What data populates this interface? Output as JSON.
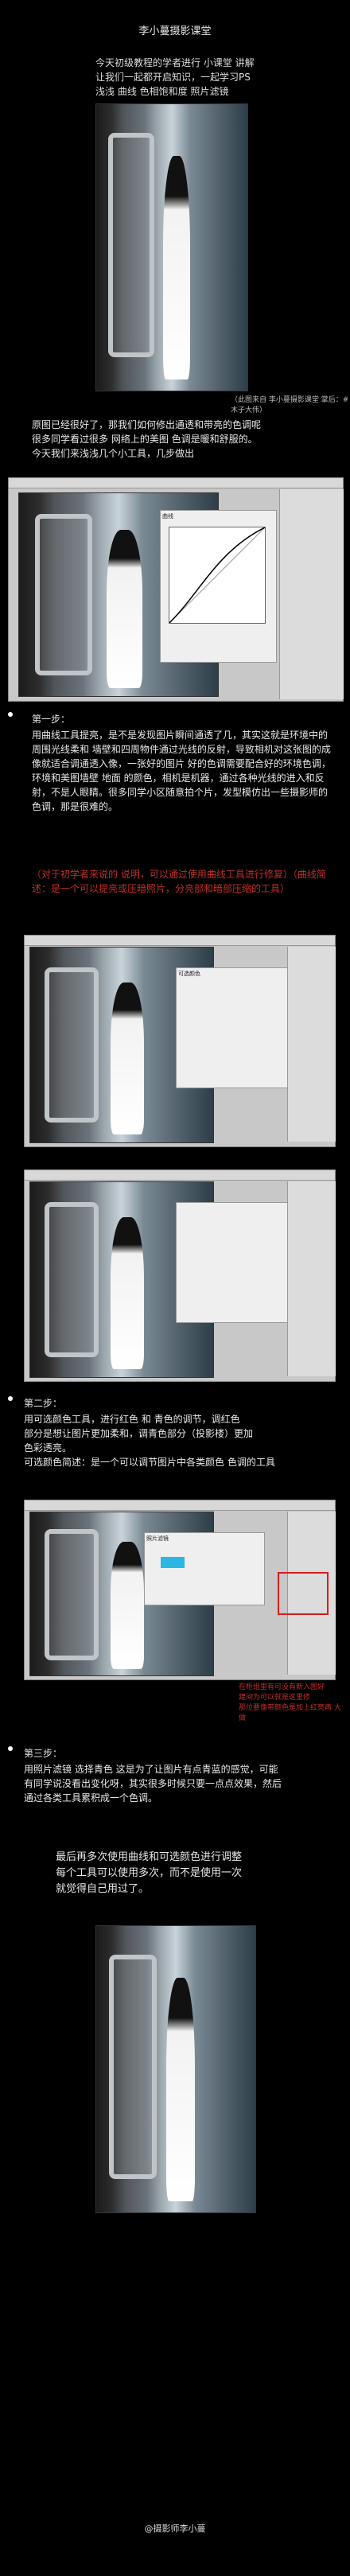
{
  "title": "李小蔓摄影课堂",
  "intro": [
    "今天初级教程的学者进行 小课堂 讲解",
    "让我们一起都开启知识，一起学习PS",
    "浅浅 曲线 色相饱和度 照片滤镜"
  ],
  "photo_caption": "（此图来自 李小蔓摄影课堂 掌后：#木子大伟）",
  "intro2": [
    "原图已经很好了，那我们如何修出通透和带亮的色调呢",
    "很多同学看过很多 网络上的美图 色调是暖和舒服的。",
    "今天我们来浅浅几个小工具，几步做出"
  ],
  "step1": {
    "heading": "第一步：",
    "body": "用曲线工具提亮，是不是发现图片瞬间通透了几，其实这就是环境中的周围光线柔和 墙壁和四周物件通过光线的反射，导致相机对这张图的成像就适合调通透入像，一张好的图片 好的色调需要配合好的环境色调，环境和美图墙壁 地面 的颜色，相机是机器，通过各种光线的进入和反射，不是人眼睛。很多同学小区随意拍个片，发型模仿出一些摄影师的色调，那是很难的。",
    "red_note": "（对于初学者来说的 说明，可以通过使用曲线工具进行修复）（曲线简述：是一个可以提亮或压暗照片，分亮部和暗部压缩的工具）"
  },
  "step2": {
    "heading": "第二步：",
    "lines": [
      "用可选颜色工具，进行红色 和 青色的调节，调红色",
      "部分是想让图片更加柔和，调青色部分（投影楼）更加",
      "色彩透亮。",
      "可选颜色简述：是一个可以调节图片中各类颜色 色调的工具"
    ]
  },
  "red_annotation": [
    "在柜组里有可没有新入图好",
    "建间为可以就是这里修",
    "那位要像带颜色是加上红亮再 大做"
  ],
  "step3": {
    "heading": "第三步：",
    "lines": [
      "用照片滤镜 选择青色 这是为了让图片有点青蓝的感觉，可能",
      "有同学说没看出变化呀，其实很多时候只要一点点效果，然后",
      "通过各类工具累积成一个色调。"
    ]
  },
  "closing": [
    "最后再多次使用曲线和可选颜色进行调整",
    "每个工具可以使用多次，而不是使用一次",
    "就觉得自己用过了。"
  ],
  "footer": "@摄影师李小蔓",
  "ps_labels": {
    "curves": "曲线",
    "selective_color": "可选颜色",
    "photo_filter": "照片滤镜"
  }
}
